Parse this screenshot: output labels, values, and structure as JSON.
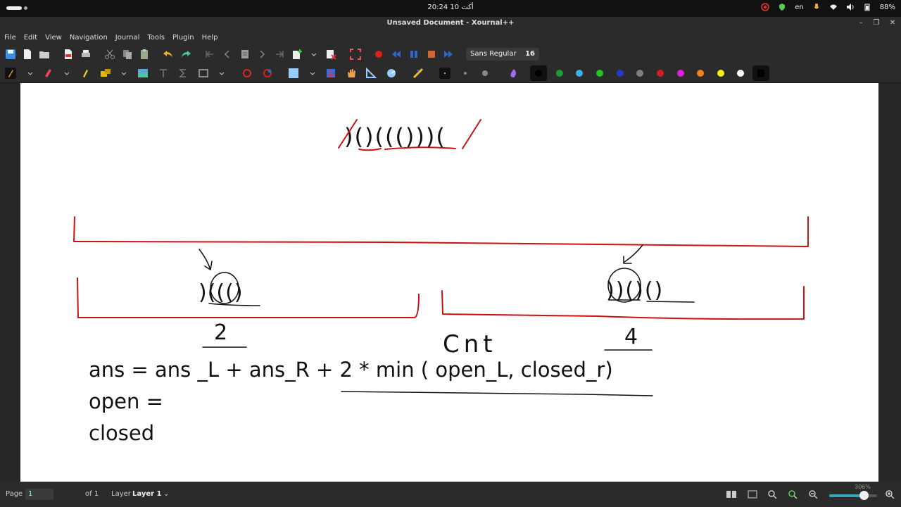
{
  "system": {
    "clock": "20:24  10 أكت",
    "keyboard_layout": "en",
    "battery": "88%"
  },
  "window": {
    "title": "Unsaved Document - Xournal++"
  },
  "menu": [
    "File",
    "Edit",
    "View",
    "Navigation",
    "Journal",
    "Tools",
    "Plugin",
    "Help"
  ],
  "font_selector": {
    "family": "Sans Regular",
    "size": "16"
  },
  "colors": {
    "pen_palette": [
      "#000000",
      "#1a9e36",
      "#3bb1ea",
      "#22c61e",
      "#2a38c9",
      "#7f7f7f",
      "#d81c1c",
      "#e020e0",
      "#f08020",
      "#f2ee10",
      "#ffffff",
      "#000000"
    ],
    "ink_red": "#cc1111",
    "ink_black": "#111111"
  },
  "canvas": {
    "top_string": ")()((()))(",
    "left_group": ")((()",
    "right_group": "))()()",
    "label_left": "2",
    "label_right": "4",
    "label_middle": "Cnt",
    "formula_line1": "ans = ans _L + ans_R + 2 * min ( open_L, closed_r)",
    "formula_line2": "open =",
    "formula_line3": "closed"
  },
  "status": {
    "page_label": "Page",
    "page_value": "1",
    "of_pages": "of 1",
    "layer_label": "Layer",
    "layer_value": "Layer 1",
    "zoom": "306%",
    "zoom_level": 0.72
  }
}
